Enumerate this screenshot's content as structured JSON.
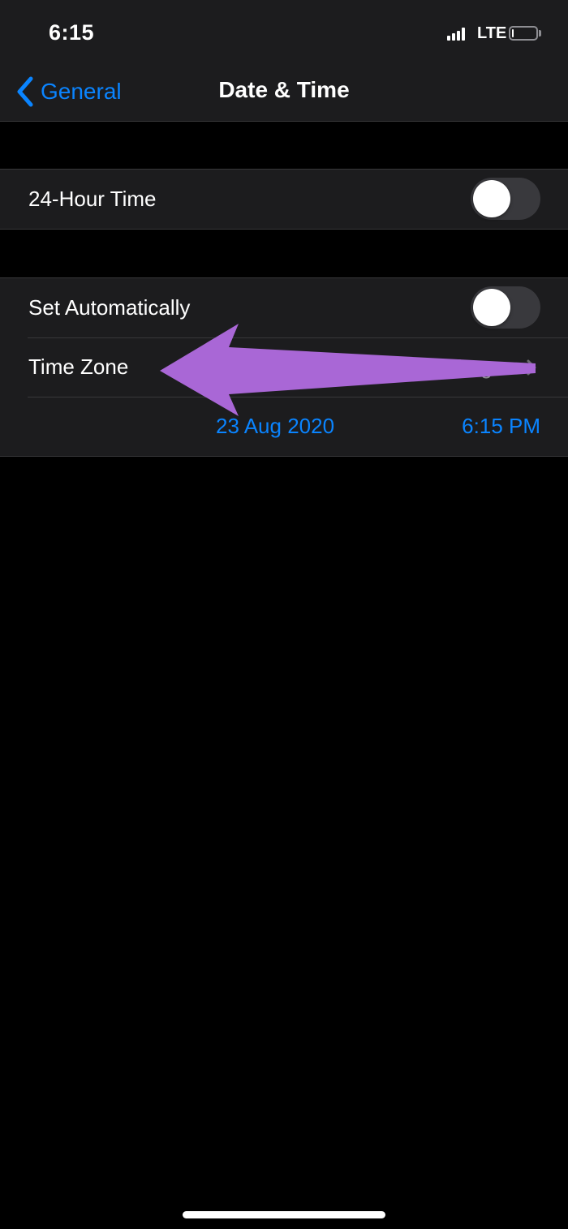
{
  "status_bar": {
    "time": "6:15",
    "network": "LTE",
    "signal_bars": 4,
    "battery_level_percent": 8
  },
  "nav": {
    "back_label": "General",
    "title": "Date & Time"
  },
  "settings": {
    "hour24": {
      "label": "24-Hour Time",
      "enabled": false
    },
    "set_automatically": {
      "label": "Set Automatically",
      "enabled": false
    },
    "time_zone": {
      "label": "Time Zone",
      "value": "Lagos"
    },
    "date": "23 Aug 2020",
    "time": "6:15 PM"
  },
  "colors": {
    "accent": "#0a84ff",
    "cell_background": "#1c1c1e",
    "page_background": "#000000",
    "annotation_arrow": "#a967d6"
  },
  "icons": {
    "back": "chevron-left-icon",
    "disclosure": "chevron-right-icon",
    "annotation": "arrow-left-annotation-icon"
  }
}
